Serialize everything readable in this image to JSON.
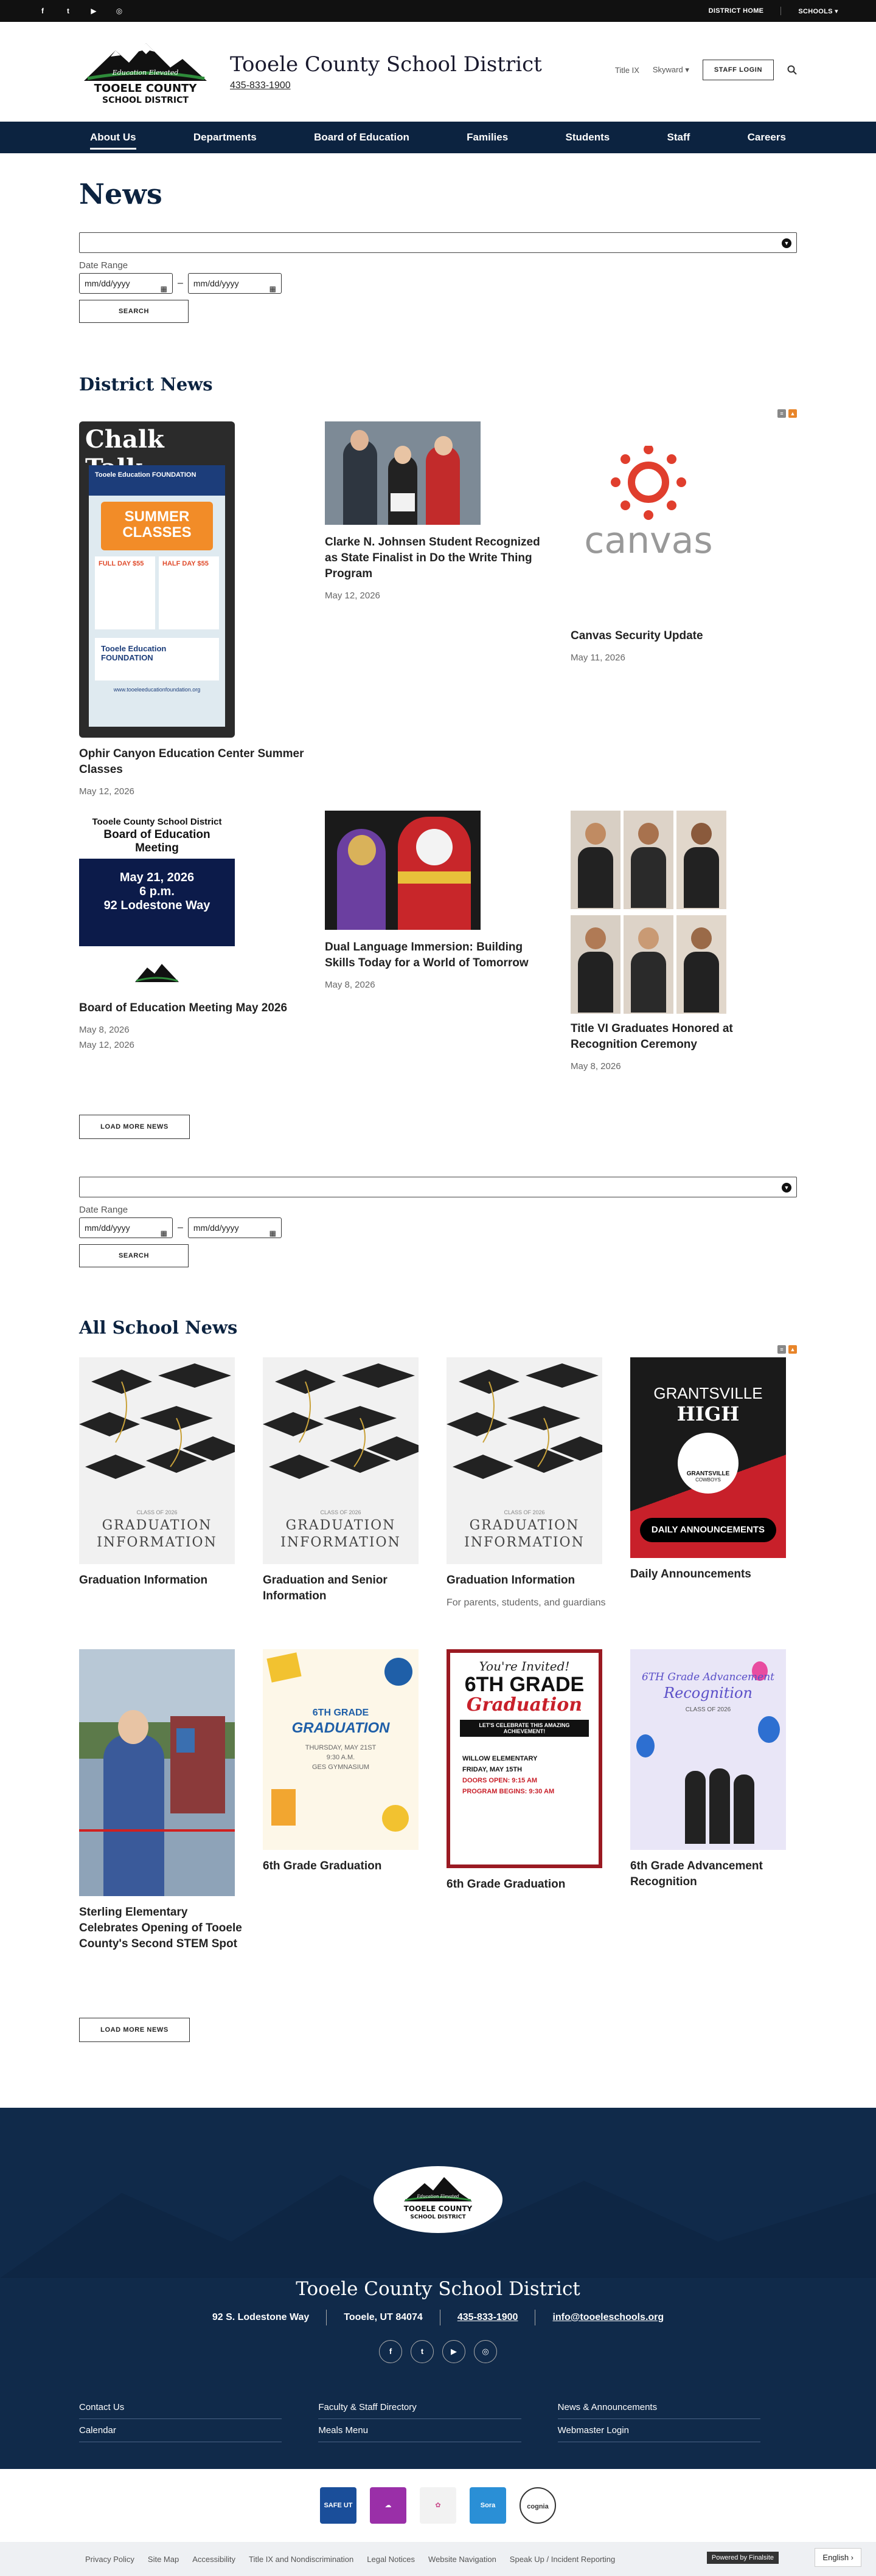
{
  "topbar": {
    "social": [
      "f",
      "t",
      "▶",
      "◎"
    ],
    "links": [
      "DISTRICT HOME",
      "SCHOOLS ▾"
    ]
  },
  "header": {
    "title": "Tooele County School District",
    "phone": "435-833-1900",
    "logo": {
      "tagline": "Education Elevated",
      "line1": "TOOELE COUNTY",
      "line2": "SCHOOL DISTRICT"
    },
    "links": [
      "Title IX",
      "Skyward ▾"
    ],
    "staff_login": "STAFF LOGIN",
    "search_icon": "search-icon"
  },
  "nav": [
    "About Us",
    "Departments",
    "Board of Education",
    "Families",
    "Students",
    "Staff",
    "Careers"
  ],
  "page_title": "News",
  "filter": {
    "date_label": "Date Range",
    "date_placeholder": "mm/dd/yyyy",
    "dash": "–",
    "search": "SEARCH"
  },
  "district_news": {
    "title": "District News",
    "load_more": "LOAD MORE NEWS",
    "items": [
      {
        "title": "Ophir Canyon Education Center Summer Classes",
        "date": "May 12, 2026"
      },
      {
        "title": "Clarke N. Johnsen Student Recognized as State Finalist in Do the Write Thing Program",
        "date": "May 12, 2026"
      },
      {
        "title": "Canvas Security Update",
        "date": "May 11, 2026"
      },
      {
        "title": "Board of Education Meeting May 2026",
        "date": "May 8, 2026",
        "date2": "May 12, 2026"
      },
      {
        "title": "Dual Language Immersion: Building Skills Today for a World of Tomorrow",
        "date": "May 8, 2026"
      },
      {
        "title": "Title VI Graduates Honored at Recognition Ceremony",
        "date": "May 8, 2026"
      }
    ],
    "chalk": {
      "head": "Chalk Talk",
      "big": "SUMMER CLASSES",
      "foundation": "Tooele Education FOUNDATION",
      "full": "FULL DAY $55",
      "half": "HALF DAY $55",
      "url": "www.tooeleeducationfoundation.org"
    },
    "canvas_word": "canvas",
    "board": {
      "l1": "Tooele County School District",
      "l2": "Board of Education Meeting",
      "l3": "May 21, 2026",
      "l4": "6 p.m.",
      "l5": "92 Lodestone Way"
    }
  },
  "school_news": {
    "title": "All School News",
    "load_more": "LOAD MORE NEWS",
    "grad_caption": {
      "l1": "CLASS OF 2026",
      "l2": "GRADUATION",
      "l3": "INFORMATION"
    },
    "grants": {
      "l1": "GRANTSVILLE",
      "l2": "HIGH",
      "l3": "GRANTSVILLE",
      "l4": "COWBOYS",
      "l5": "DAILY ANNOUNCEMENTS"
    },
    "sixth1": {
      "l1": "6TH GRADE",
      "l2": "GRADUATION",
      "l3": "THURSDAY, MAY 21ST",
      "l4": "9:30 A.M.",
      "l5": "GES GYMNASIUM"
    },
    "sixth2": {
      "l1": "You're Invited!",
      "l2": "6TH GRADE",
      "l3": "Graduation",
      "l4": "LET'S CELEBRATE THIS AMAZING ACHIEVEMENT!",
      "l5": "WILLOW ELEMENTARY",
      "l6": "FRIDAY, MAY 15TH",
      "l7": "DOORS OPEN: 9:15 AM",
      "l8": "PROGRAM BEGINS: 9:30 AM"
    },
    "sixth3": {
      "l1": "6TH Grade Advancement",
      "l2": "Recognition",
      "l3": "CLASS OF 2026"
    },
    "items": [
      {
        "title": "Graduation Information",
        "sub": ""
      },
      {
        "title": "Graduation and Senior Information",
        "sub": ""
      },
      {
        "title": "Graduation Information",
        "sub": "For parents, students, and guardians"
      },
      {
        "title": "Daily Announcements",
        "sub": ""
      },
      {
        "title": "Sterling Elementary Celebrates Opening of Tooele County's Second STEM Spot",
        "sub": ""
      },
      {
        "title": "6th Grade Graduation",
        "sub": ""
      },
      {
        "title": "6th Grade Graduation",
        "sub": ""
      },
      {
        "title": "6th Grade Advancement Recognition",
        "sub": ""
      }
    ]
  },
  "footer": {
    "title": "Tooele County School District",
    "address": "92 S. Lodestone Way",
    "city": "Tooele, UT  84074",
    "phone": "435-833-1900",
    "email": "info@tooeleschools.org",
    "social": [
      "f",
      "t",
      "▶",
      "◎"
    ],
    "links": [
      "Contact Us",
      "Faculty & Staff Directory",
      "News & Announcements",
      "Calendar",
      "Meals Menu",
      "Webmaster Login"
    ],
    "partners": [
      "SAFE UT",
      "☁",
      "✿",
      "Sora",
      "cognia"
    ],
    "bottom_links": [
      "Privacy Policy",
      "Site Map",
      "Accessibility",
      "Title IX and Nondiscrimination",
      "Legal Notices",
      "Website Navigation",
      "Speak Up / Incident Reporting"
    ],
    "powered": "Powered by Finalsite",
    "language": "English ›"
  }
}
